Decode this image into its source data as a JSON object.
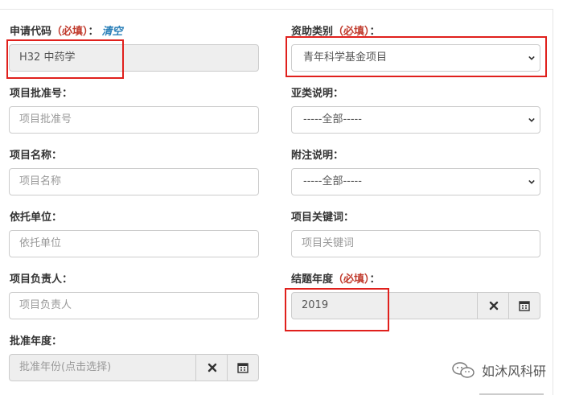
{
  "form": {
    "apply_code": {
      "label": "申请代码",
      "required": "（必填）",
      "colon": "：",
      "clear": "清空",
      "value": "H32 中药学"
    },
    "funding_category": {
      "label": "资助类别",
      "required": "（必填）",
      "colon": "：",
      "value": "青年科学基金项目"
    },
    "approval_number": {
      "label": "项目批准号：",
      "placeholder": "项目批准号"
    },
    "subcategory_note": {
      "label": "亚类说明：",
      "value": "-----全部-----"
    },
    "project_name": {
      "label": "项目名称：",
      "placeholder": "项目名称"
    },
    "annotation_note": {
      "label": "附注说明：",
      "value": "-----全部-----"
    },
    "host_institution": {
      "label": "依托单位：",
      "placeholder": "依托单位"
    },
    "keywords": {
      "label": "项目关键词：",
      "placeholder": "项目关键词"
    },
    "project_leader": {
      "label": "项目负责人：",
      "placeholder": "项目负责人"
    },
    "conclusion_year": {
      "label": "结题年度",
      "required": "（必填）",
      "colon": "：",
      "value": "2019"
    },
    "approval_year": {
      "label": "批准年度：",
      "placeholder": "批准年份(点击选择)"
    }
  },
  "watermark": {
    "text": "如沐风科研"
  },
  "colors": {
    "required": "#c0392b",
    "link": "#2a7fb8",
    "highlight": "#e0201c"
  },
  "icons": [
    "chevron-down-icon",
    "clear-x-icon",
    "calendar-icon",
    "wechat-icon"
  ]
}
